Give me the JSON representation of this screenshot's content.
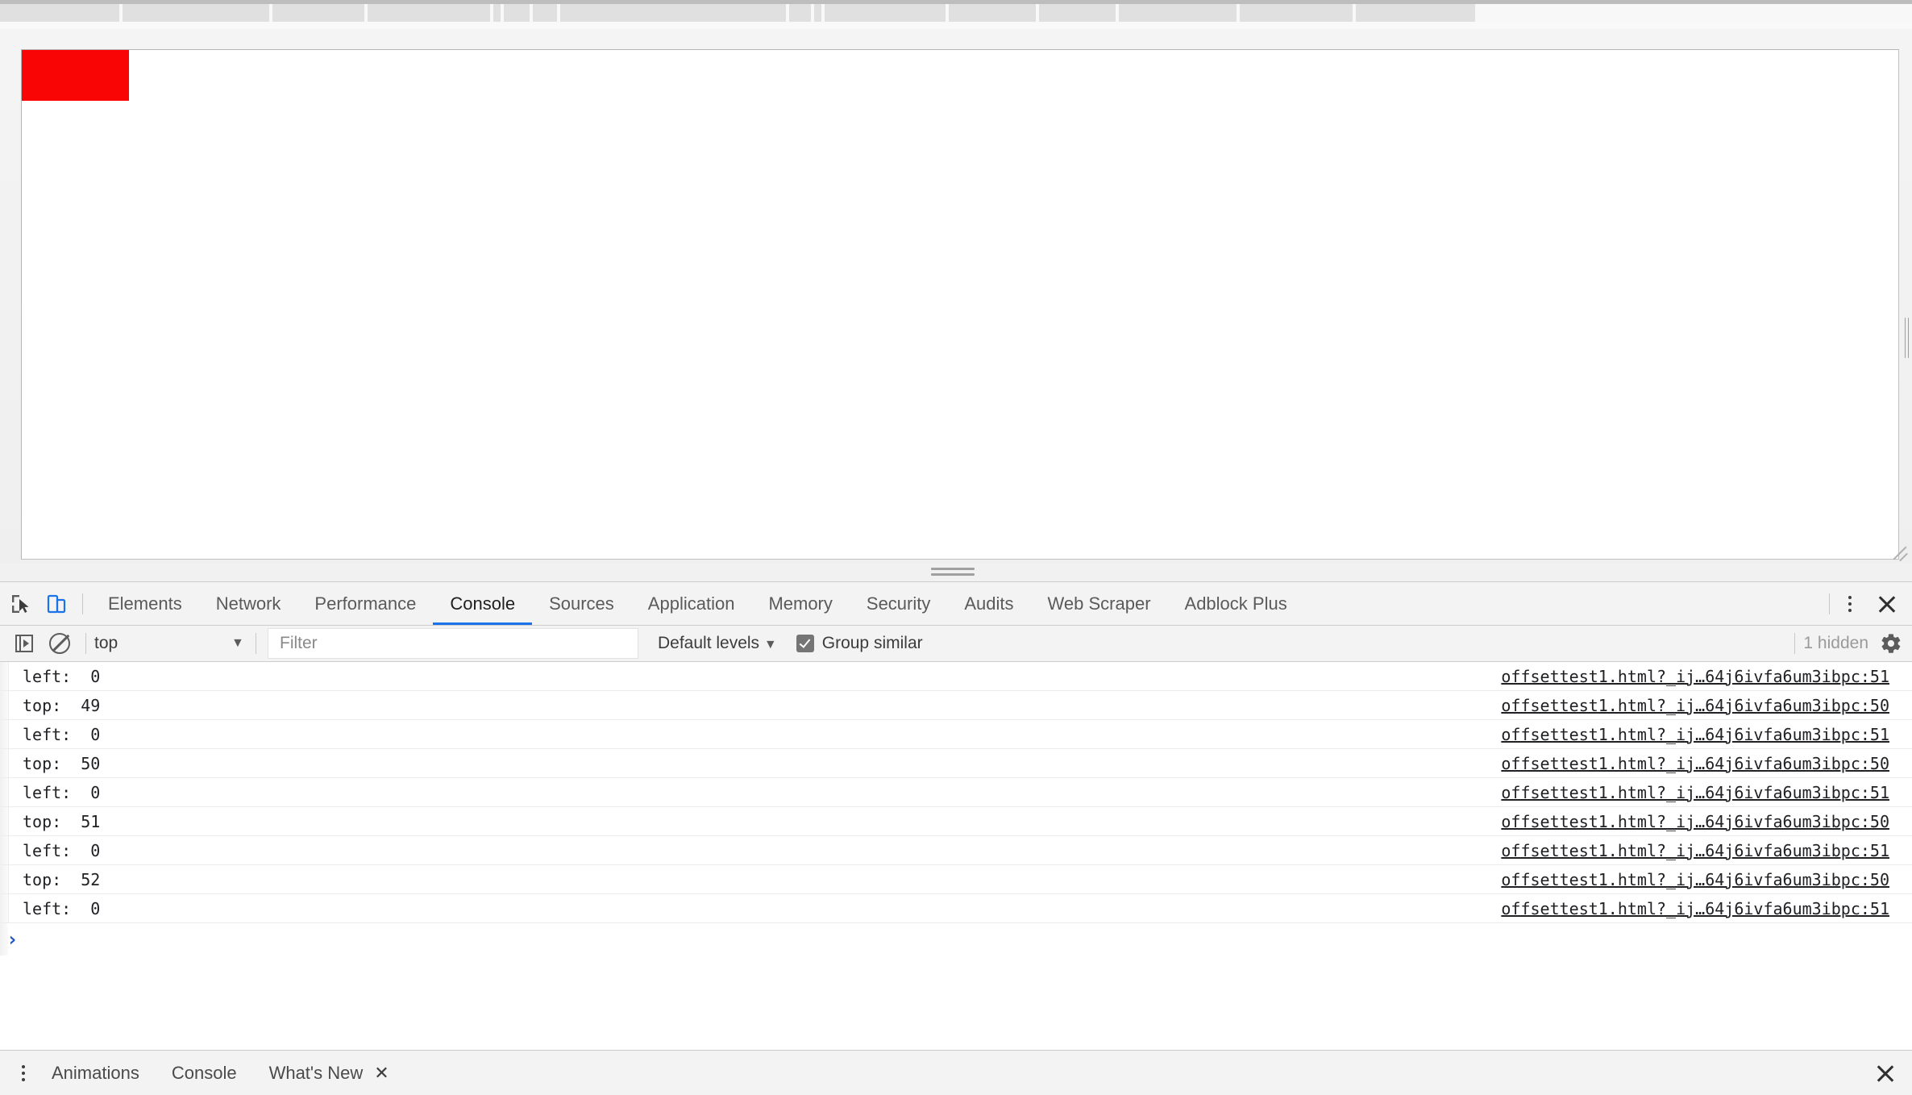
{
  "browser_chrome": {
    "tab_widths": [
      148,
      182,
      114,
      152,
      9,
      32,
      30,
      280,
      27,
      9,
      150,
      108,
      95,
      146,
      140,
      148
    ]
  },
  "page": {
    "red_box": {
      "color": "#fa0505",
      "label": "red-rectangle"
    },
    "resize_handles": {
      "vertical": "vertical-resize-grip",
      "corner": "corner-resize-grip"
    }
  },
  "splitter": {
    "name": "devtools-horizontal-splitter"
  },
  "devtools": {
    "toolbar_icons": {
      "inspect": "inspect-element-icon",
      "device": "device-toolbar-icon",
      "more": "more-options-icon",
      "close": "close-devtools-icon"
    },
    "tabs": [
      {
        "label": "Elements",
        "active": false
      },
      {
        "label": "Network",
        "active": false
      },
      {
        "label": "Performance",
        "active": false
      },
      {
        "label": "Console",
        "active": true
      },
      {
        "label": "Sources",
        "active": false
      },
      {
        "label": "Application",
        "active": false
      },
      {
        "label": "Memory",
        "active": false
      },
      {
        "label": "Security",
        "active": false
      },
      {
        "label": "Audits",
        "active": false
      },
      {
        "label": "Web Scraper",
        "active": false
      },
      {
        "label": "Adblock Plus",
        "active": false
      }
    ],
    "filter_bar": {
      "sidebar_toggle_icon": "console-sidebar-toggle-icon",
      "clear_icon": "clear-console-icon",
      "context_value": "top",
      "context_caret": "▼",
      "filter_placeholder": "Filter",
      "filter_value": "",
      "levels_label": "Default levels",
      "levels_caret": "▼",
      "group_similar_label": "Group similar",
      "group_similar_checked": true,
      "hidden_count": "1 hidden",
      "settings_icon": "gear-icon"
    },
    "console_rows": [
      {
        "message": "left:  0",
        "source": "offsettest1.html?_ij…64j6ivfa6um3ibpc:51"
      },
      {
        "message": "top:  49",
        "source": "offsettest1.html?_ij…64j6ivfa6um3ibpc:50"
      },
      {
        "message": "left:  0",
        "source": "offsettest1.html?_ij…64j6ivfa6um3ibpc:51"
      },
      {
        "message": "top:  50",
        "source": "offsettest1.html?_ij…64j6ivfa6um3ibpc:50"
      },
      {
        "message": "left:  0",
        "source": "offsettest1.html?_ij…64j6ivfa6um3ibpc:51"
      },
      {
        "message": "top:  51",
        "source": "offsettest1.html?_ij…64j6ivfa6um3ibpc:50"
      },
      {
        "message": "left:  0",
        "source": "offsettest1.html?_ij…64j6ivfa6um3ibpc:51"
      },
      {
        "message": "top:  52",
        "source": "offsettest1.html?_ij…64j6ivfa6um3ibpc:50"
      },
      {
        "message": "left:  0",
        "source": "offsettest1.html?_ij…64j6ivfa6um3ibpc:51"
      }
    ],
    "prompt": {
      "chevron": "›",
      "value": ""
    },
    "drawer": {
      "more_icon": "drawer-more-options-icon",
      "tabs": [
        {
          "label": "Animations",
          "closable": false
        },
        {
          "label": "Console",
          "closable": false
        },
        {
          "label": "What's New",
          "closable": true,
          "close_glyph": "✕"
        }
      ],
      "close_icon": "close-drawer-icon"
    }
  },
  "colors": {
    "accent": "#1a73e8",
    "red": "#fa0505",
    "prompt_blue": "#1a56c4",
    "toolbar_bg": "#f3f3f3"
  }
}
